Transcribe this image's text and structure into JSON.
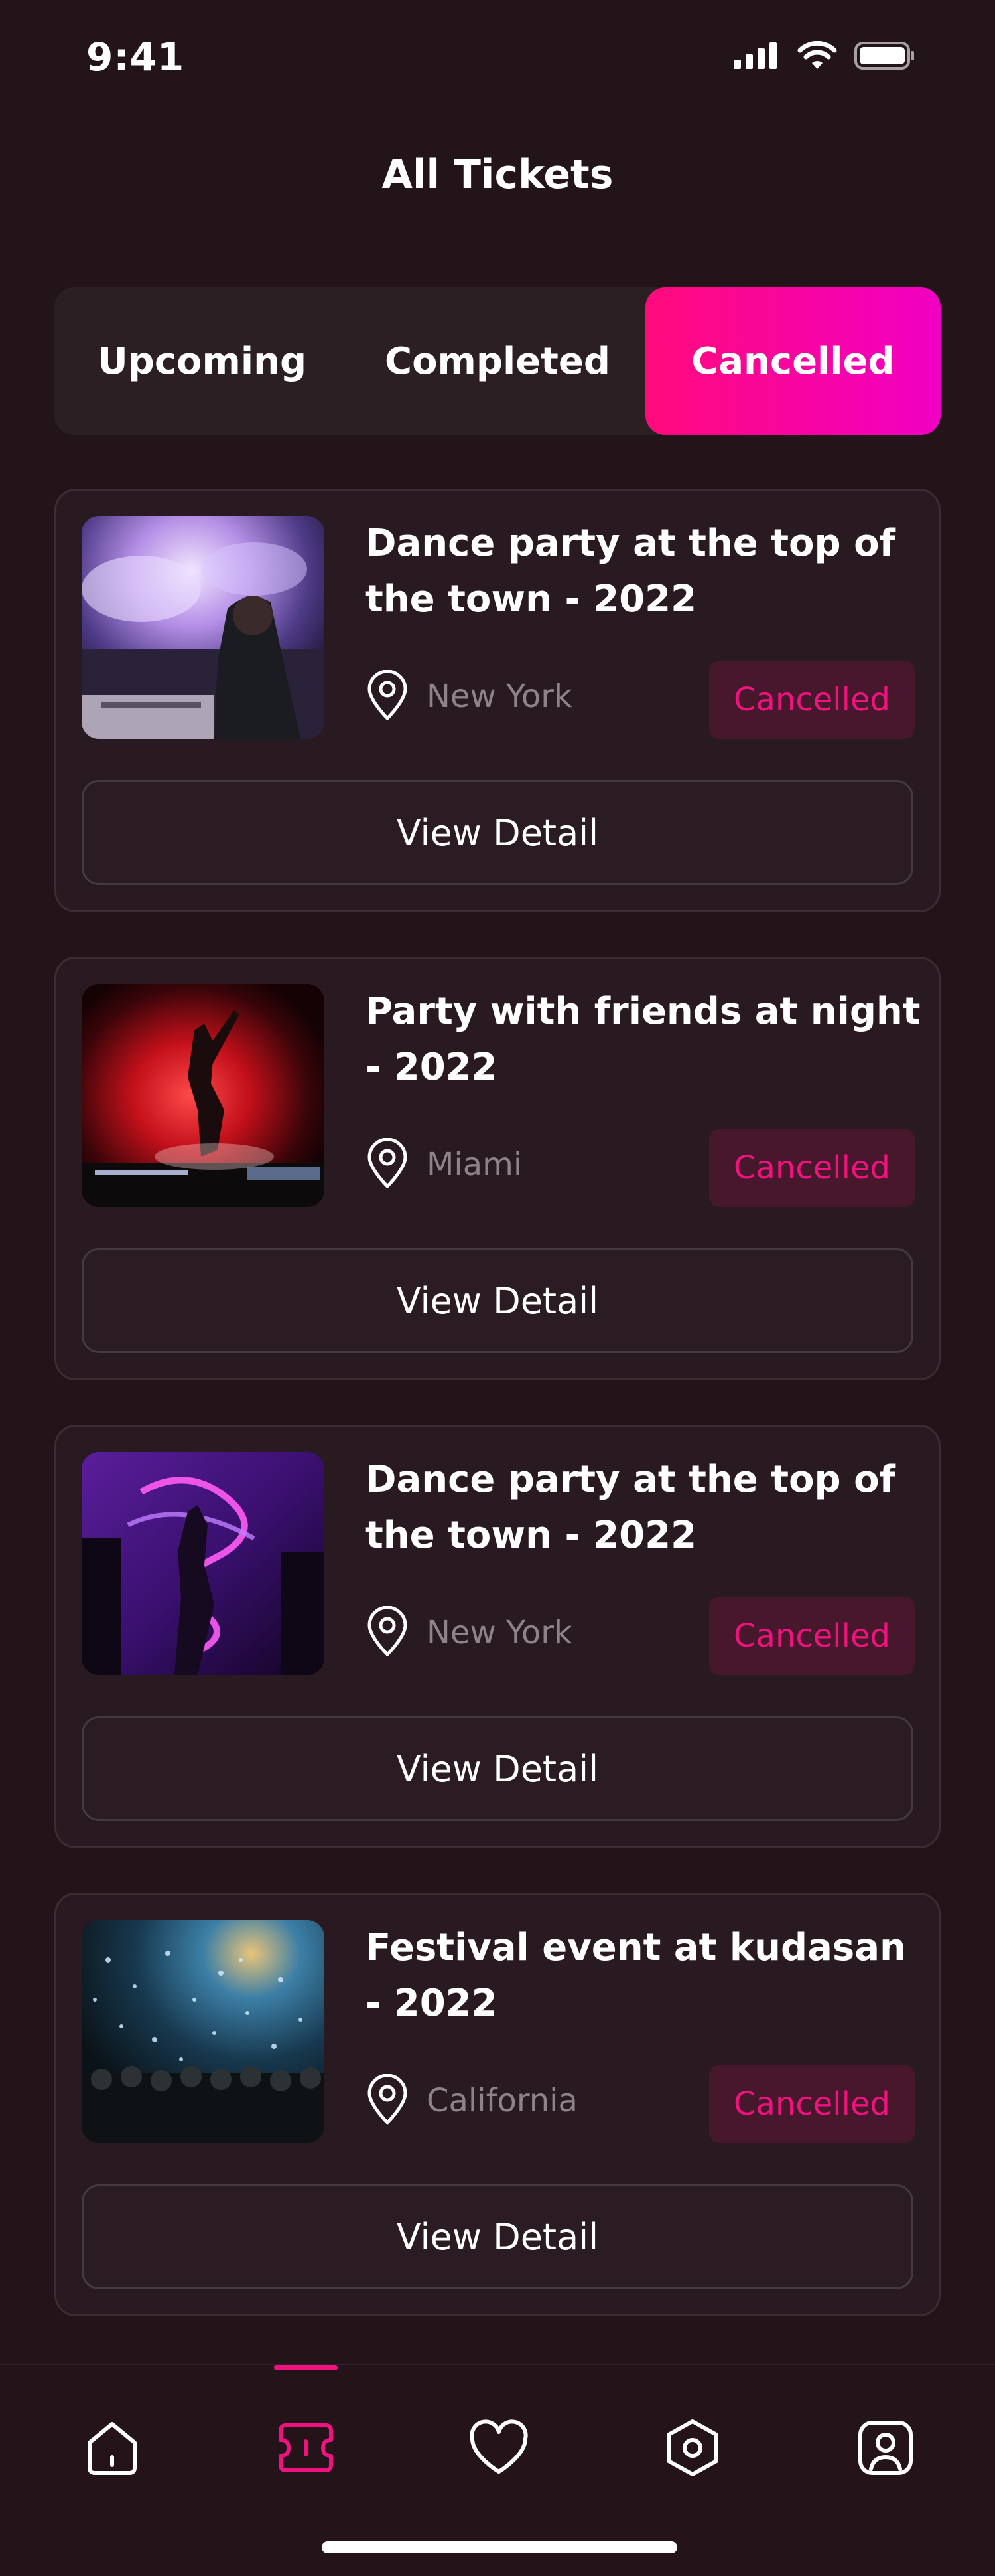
{
  "status_bar": {
    "time": "9:41"
  },
  "header": {
    "title": "All Tickets"
  },
  "tabs": [
    {
      "label": "Upcoming",
      "active": false
    },
    {
      "label": "Completed",
      "active": false
    },
    {
      "label": "Cancelled",
      "active": true
    }
  ],
  "tickets": [
    {
      "title": "Dance party at the top of the town - 2022",
      "location": "New York",
      "status": "Cancelled",
      "button": "View Detail",
      "image": "dj-concert-photo"
    },
    {
      "title": "Party with friends at night - 2022",
      "location": "Miami",
      "status": "Cancelled",
      "button": "View Detail",
      "image": "dancer-red-light-photo"
    },
    {
      "title": "Dance party at the top of the town - 2022",
      "location": "New York",
      "status": "Cancelled",
      "button": "View Detail",
      "image": "neon-dance-photo"
    },
    {
      "title": "Festival event at kudasan - 2022",
      "location": "California",
      "status": "Cancelled",
      "button": "View Detail",
      "image": "festival-confetti-photo"
    }
  ],
  "bottom_nav": [
    {
      "icon": "home-icon",
      "active": false
    },
    {
      "icon": "ticket-icon",
      "active": true
    },
    {
      "icon": "heart-icon",
      "active": false
    },
    {
      "icon": "settings-icon",
      "active": false
    },
    {
      "icon": "profile-icon",
      "active": false
    }
  ],
  "colors": {
    "background": "#231419",
    "accent": "#f0127e",
    "accent_gradient_end": "#f100c4",
    "badge_bg": "#47172b",
    "muted_text": "#8d8388"
  }
}
